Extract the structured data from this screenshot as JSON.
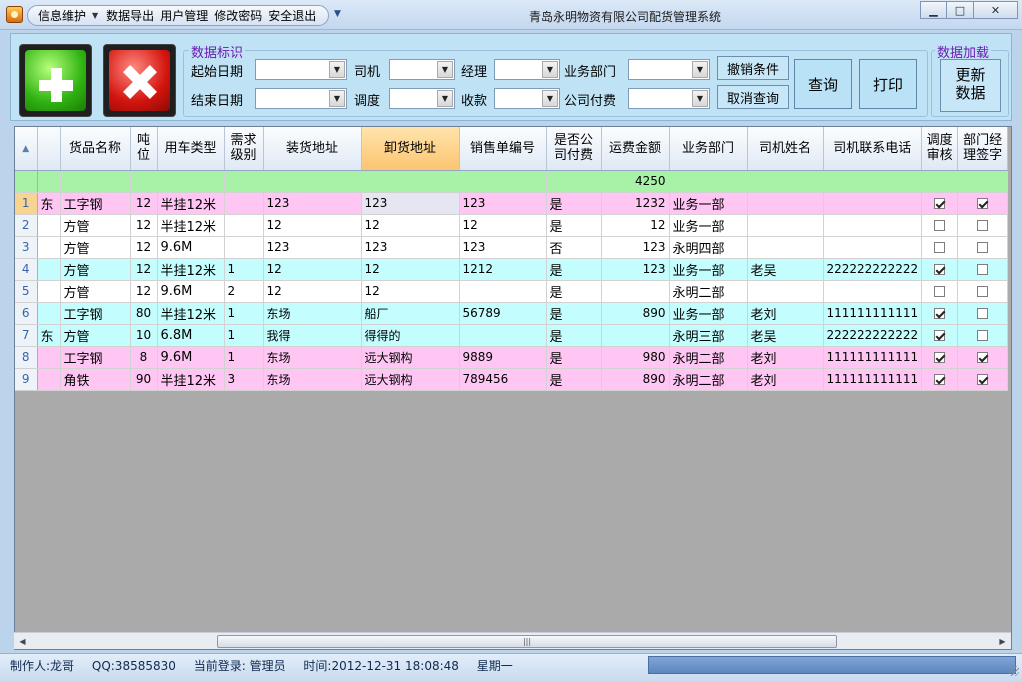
{
  "titlebar": {
    "menu": [
      "信息维护",
      "数据导出",
      "用户管理",
      "修改密码",
      "安全退出"
    ],
    "window_title": "青岛永明物资有限公司配货管理系统"
  },
  "filters": {
    "group_label": "数据标识",
    "group_label2": "数据加载",
    "start_date_label": "起始日期",
    "end_date_label": "结束日期",
    "driver_label": "司机",
    "dispatch_label": "调度",
    "manager_label": "经理",
    "payment_label": "收款",
    "dept_label": "业务部门",
    "company_pay_label": "公司付费",
    "revoke_label": "撤销条件",
    "cancel_query_label": "取消查询",
    "query_label": "查询",
    "print_label": "打印",
    "update_line1": "更新",
    "update_line2": "数据"
  },
  "grid": {
    "columns": [
      [
        "货品名称"
      ],
      [
        "吨",
        "位"
      ],
      [
        "用车类型"
      ],
      [
        "需求",
        "级别"
      ],
      [
        "装货地址"
      ],
      [
        "卸货地址"
      ],
      [
        "销售单编号"
      ],
      [
        "是否公",
        "司付费"
      ],
      [
        "运费金额"
      ],
      [
        "业务部门"
      ],
      [
        "司机姓名"
      ],
      [
        "司机联系电话"
      ],
      [
        "调度",
        "审核"
      ],
      [
        "部门经",
        "理签字"
      ]
    ],
    "sum_freight": "4250",
    "rows": [
      {
        "no": "1",
        "lead": "东",
        "goods": "工字钢",
        "ton": "12",
        "vehicle": "半挂12米",
        "level": "",
        "load": "123",
        "unload": "123",
        "sale": "123",
        "company_pay": "是",
        "freight": "1232",
        "dept": "业务一部",
        "driver": "",
        "phone": "",
        "audit": true,
        "sign": true
      },
      {
        "no": "2",
        "lead": "",
        "goods": "方管",
        "ton": "12",
        "vehicle": "半挂12米",
        "level": "",
        "load": "12",
        "unload": "12",
        "sale": "12",
        "company_pay": "是",
        "freight": "12",
        "dept": "业务一部",
        "driver": "",
        "phone": "",
        "audit": false,
        "sign": false
      },
      {
        "no": "3",
        "lead": "",
        "goods": "方管",
        "ton": "12",
        "vehicle": "9.6M",
        "level": "",
        "load": "123",
        "unload": "123",
        "sale": "123",
        "company_pay": "否",
        "freight": "123",
        "dept": "永明四部",
        "driver": "",
        "phone": "",
        "audit": false,
        "sign": false
      },
      {
        "no": "4",
        "lead": "",
        "goods": "方管",
        "ton": "12",
        "vehicle": "半挂12米",
        "level": "1",
        "load": "12",
        "unload": "12",
        "sale": "1212",
        "company_pay": "是",
        "freight": "123",
        "dept": "业务一部",
        "driver": "老吴",
        "phone": "222222222222",
        "audit": true,
        "sign": false
      },
      {
        "no": "5",
        "lead": "",
        "goods": "方管",
        "ton": "12",
        "vehicle": "9.6M",
        "level": "2",
        "load": "12",
        "unload": "12",
        "sale": "",
        "company_pay": "是",
        "freight": "",
        "dept": "永明二部",
        "driver": "",
        "phone": "",
        "audit": false,
        "sign": false
      },
      {
        "no": "6",
        "lead": "",
        "goods": "工字钢",
        "ton": "80",
        "vehicle": "半挂12米",
        "level": "1",
        "load": "东场",
        "unload": "船厂",
        "sale": "56789",
        "company_pay": "是",
        "freight": "890",
        "dept": "业务一部",
        "driver": "老刘",
        "phone": "111111111111",
        "audit": true,
        "sign": false
      },
      {
        "no": "7",
        "lead": "东",
        "goods": "方管",
        "ton": "10",
        "vehicle": "6.8M",
        "level": "1",
        "load": "我得",
        "unload": "得得的",
        "sale": "",
        "company_pay": "是",
        "freight": "",
        "dept": "永明三部",
        "driver": "老吴",
        "phone": "222222222222",
        "audit": true,
        "sign": false
      },
      {
        "no": "8",
        "lead": "",
        "goods": "工字钢",
        "ton": "8",
        "vehicle": "9.6M",
        "level": "1",
        "load": "东场",
        "unload": "远大钢构",
        "sale": "9889",
        "company_pay": "是",
        "freight": "980",
        "dept": "永明二部",
        "driver": "老刘",
        "phone": "111111111111",
        "audit": true,
        "sign": true
      },
      {
        "no": "9",
        "lead": "",
        "goods": "角铁",
        "ton": "90",
        "vehicle": "半挂12米",
        "level": "3",
        "load": "东场",
        "unload": "远大钢构",
        "sale": "789456",
        "company_pay": "是",
        "freight": "890",
        "dept": "永明二部",
        "driver": "老刘",
        "phone": "111111111111",
        "audit": true,
        "sign": true
      }
    ],
    "row_styles": [
      "pink",
      "white",
      "white",
      "cyan",
      "white",
      "cyan",
      "cyan",
      "pink",
      "pink"
    ]
  },
  "status": {
    "author": "制作人:龙哥",
    "qq": "QQ:38585830",
    "login": "当前登录: 管理员",
    "time": "时间:2012-12-31 18:08:48",
    "weekday": "星期一"
  },
  "colors": {
    "sum_row": "#a7f2a7",
    "pink_row": "#ffc6f4",
    "cyan_row": "#c4fdfd",
    "panel_bg": "#bfe3f5",
    "group_label": "#6a1bb1"
  }
}
